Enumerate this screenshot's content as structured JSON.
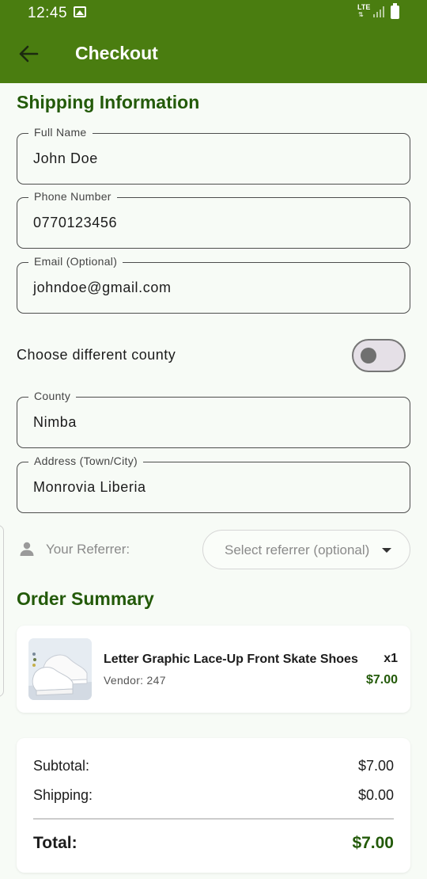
{
  "status_bar": {
    "time": "12:45",
    "network": "LTE",
    "image_icon": "image-notification-icon",
    "signal_icon": "signal-icon",
    "battery_icon": "battery-icon"
  },
  "app_bar": {
    "title": "Checkout",
    "back_icon": "arrow-back-icon",
    "background_color": "#4a7d10"
  },
  "shipping": {
    "title": "Shipping Information",
    "fields": [
      {
        "label": "Full Name",
        "value": "John Doe"
      },
      {
        "label": "Phone Number",
        "value": "0770123456"
      },
      {
        "label": "Email (Optional)",
        "value": "johndoe@gmail.com"
      }
    ],
    "toggle": {
      "label": "Choose different county",
      "on": false
    },
    "county": {
      "label": "County",
      "value": "Nimba"
    },
    "address": {
      "label": "Address (Town/City)",
      "value": "Monrovia Liberia"
    },
    "referrer": {
      "label": "Your Referrer:",
      "placeholder": "Select referrer (optional)",
      "icon": "person-icon"
    }
  },
  "order_summary": {
    "title": "Order Summary",
    "items": [
      {
        "name": "Letter Graphic Lace-Up Front Skate Shoes",
        "vendor": "Vendor: 247",
        "qty": "x1",
        "price": "$7.00"
      }
    ],
    "subtotal_label": "Subtotal:",
    "subtotal_value": "$7.00",
    "shipping_label": "Shipping:",
    "shipping_value": "$0.00",
    "total_label": "Total:",
    "total_value": "$7.00"
  },
  "colors": {
    "primary": "#4a7d10",
    "heading_green": "#235a09",
    "background": "#f7fbf6"
  }
}
